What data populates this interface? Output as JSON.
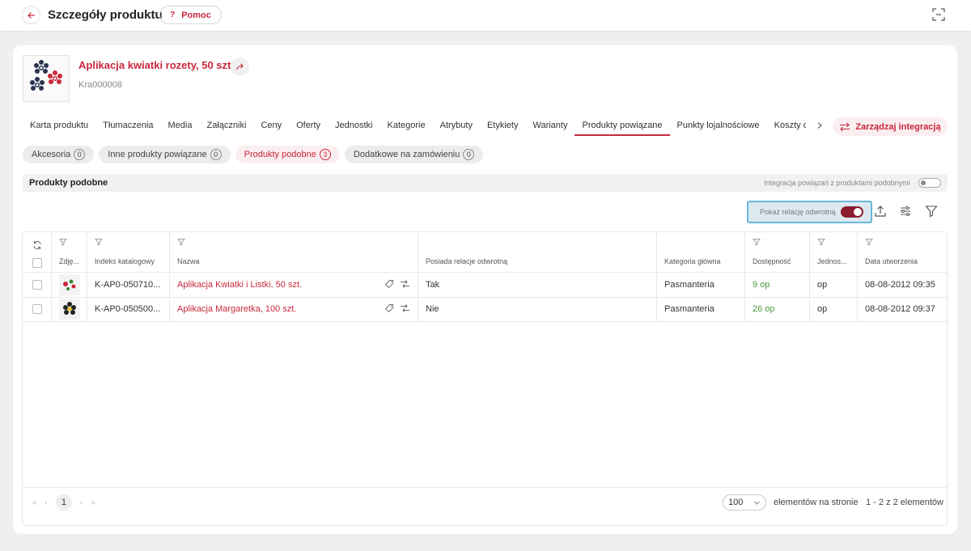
{
  "header": {
    "title": "Szczegóły produktu",
    "help_label": "Pomoc"
  },
  "product": {
    "name": "Aplikacja kwiatki rozety, 50 szt.",
    "code": "Kra000008"
  },
  "tabs": [
    {
      "label": "Karta produktu"
    },
    {
      "label": "Tłumaczenia"
    },
    {
      "label": "Media"
    },
    {
      "label": "Załączniki"
    },
    {
      "label": "Ceny"
    },
    {
      "label": "Oferty"
    },
    {
      "label": "Jednostki"
    },
    {
      "label": "Kategorie"
    },
    {
      "label": "Atrybuty"
    },
    {
      "label": "Etykiety"
    },
    {
      "label": "Warianty"
    },
    {
      "label": "Produkty powiązane"
    },
    {
      "label": "Punkty lojalnościowe"
    },
    {
      "label": "Koszty d"
    }
  ],
  "integration_button": "Zarządzaj integracją",
  "relation_chips": [
    {
      "label": "Akcesoria",
      "count": "0"
    },
    {
      "label": "Inne produkty powiązane",
      "count": "0"
    },
    {
      "label": "Produkty podobne",
      "count": "3"
    },
    {
      "label": "Dodatkowe na zamówieniu",
      "count": "0"
    }
  ],
  "section": {
    "title": "Produkty podobne",
    "integration_toggle_label": "Integracja powiązań z produktami podobnymi",
    "reverse_toggle_label": "Pokaż relację odwrotną"
  },
  "table": {
    "columns": {
      "image": "Zdję...",
      "catalog_index": "Indeks katalogowy",
      "name": "Nazwa",
      "has_reverse": "Posiada relacje odwrotną",
      "main_category": "Kategoria główna",
      "availability": "Dostępność",
      "unit": "Jednos...",
      "created": "Data utworzenia"
    },
    "rows": [
      {
        "catalog_index": "K-AP0-050710...",
        "name": "Aplikacja Kwiatki i Listki, 50 szt.",
        "has_reverse": "Tak",
        "main_category": "Pasmanteria",
        "availability": "9 op",
        "unit": "op",
        "created": "08-08-2012 09:35"
      },
      {
        "catalog_index": "K-AP0-050500...",
        "name": "Aplikacja Margaretka, 100 szt.",
        "has_reverse": "Nie",
        "main_category": "Pasmanteria",
        "availability": "26 op",
        "unit": "op",
        "created": "08-08-2012 09:37"
      }
    ]
  },
  "pagination": {
    "current_page": "1",
    "per_page": "100",
    "per_page_label": "elementów na stronie",
    "range": "1 - 2 z 2 elementów"
  },
  "colors": {
    "accent": "#c8283c",
    "toggle_on": "#8c1d2e",
    "availability": "#4e9a3a",
    "highlight_border": "#6ab7dc"
  }
}
